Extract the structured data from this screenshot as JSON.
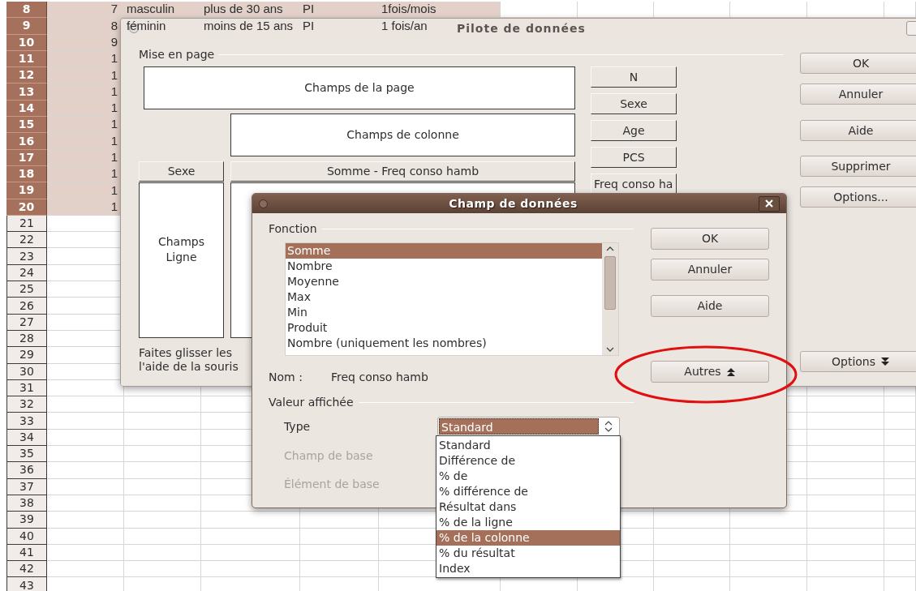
{
  "sheet": {
    "rows": [
      {
        "header": "8",
        "selected": true,
        "cells": [
          "7",
          "masculin",
          "plus de 30 ans",
          "PI",
          "1fois/mois"
        ]
      },
      {
        "header": "9",
        "selected": true,
        "cells": [
          "8",
          "féminin",
          "moins de 15 ans",
          "PI",
          "1 fois/an"
        ]
      },
      {
        "header": "10",
        "selected": true,
        "cells": [
          "9"
        ]
      },
      {
        "header": "11",
        "selected": true,
        "cells": [
          "1"
        ]
      },
      {
        "header": "12",
        "selected": true,
        "cells": [
          "1"
        ]
      },
      {
        "header": "13",
        "selected": true,
        "cells": [
          "1"
        ]
      },
      {
        "header": "14",
        "selected": true,
        "cells": [
          "1"
        ]
      },
      {
        "header": "15",
        "selected": true,
        "cells": [
          "1"
        ]
      },
      {
        "header": "16",
        "selected": true,
        "cells": [
          "1"
        ]
      },
      {
        "header": "17",
        "selected": true,
        "cells": [
          "1"
        ]
      },
      {
        "header": "18",
        "selected": true,
        "cells": [
          "1"
        ]
      },
      {
        "header": "19",
        "selected": true,
        "cells": [
          "1"
        ]
      },
      {
        "header": "20",
        "selected": true,
        "cells": [
          "1"
        ]
      },
      {
        "header": "21",
        "selected": false
      },
      {
        "header": "22",
        "selected": false
      },
      {
        "header": "23",
        "selected": false
      },
      {
        "header": "24",
        "selected": false
      },
      {
        "header": "25",
        "selected": false
      },
      {
        "header": "26",
        "selected": false
      },
      {
        "header": "27",
        "selected": false
      },
      {
        "header": "28",
        "selected": false
      },
      {
        "header": "29",
        "selected": false
      },
      {
        "header": "30",
        "selected": false
      },
      {
        "header": "31",
        "selected": false
      },
      {
        "header": "32",
        "selected": false
      },
      {
        "header": "33",
        "selected": false
      },
      {
        "header": "34",
        "selected": false
      },
      {
        "header": "35",
        "selected": false
      },
      {
        "header": "36",
        "selected": false
      },
      {
        "header": "37",
        "selected": false
      },
      {
        "header": "38",
        "selected": false
      },
      {
        "header": "39",
        "selected": false
      },
      {
        "header": "40",
        "selected": false
      },
      {
        "header": "41",
        "selected": false
      },
      {
        "header": "42",
        "selected": false
      },
      {
        "header": "43",
        "selected": false
      }
    ]
  },
  "pilot_dialog": {
    "title": "Pilote de données",
    "layout_label": "Mise en page",
    "page_area": "Champs de la page",
    "column_area": "Champs de colonne",
    "row_field": "Sexe",
    "data_field": "Somme - Freq conso hamb",
    "row_area": "Champs Ligne",
    "hint": "Faites glisser les\nl'aide de la souris",
    "field_buttons": [
      "N",
      "Sexe",
      "Age",
      "PCS",
      "Freq conso ha"
    ],
    "buttons": [
      "OK",
      "Annuler",
      "Aide",
      "Supprimer",
      "Options..."
    ],
    "options_button": "Options"
  },
  "field_dialog": {
    "title": "Champ de données",
    "function_label": "Fonction",
    "functions": [
      {
        "label": "Somme",
        "selected": true
      },
      {
        "label": "Nombre",
        "selected": false
      },
      {
        "label": "Moyenne",
        "selected": false
      },
      {
        "label": "Max",
        "selected": false
      },
      {
        "label": "Min",
        "selected": false
      },
      {
        "label": "Produit",
        "selected": false
      },
      {
        "label": "Nombre (uniquement les nombres)",
        "selected": false
      }
    ],
    "name_label": "Nom :",
    "name_value": "Freq conso hamb",
    "displayed_label": "Valeur affichée",
    "type": {
      "label": "Type",
      "value": "Standard"
    },
    "base_rows": [
      {
        "label": "Champ de base",
        "disabled": true
      },
      {
        "label": "Élément de base",
        "disabled": true
      }
    ],
    "buttons": [
      "OK",
      "Annuler",
      "Aide"
    ],
    "more_button": "Autres"
  },
  "type_dropdown": {
    "options": [
      {
        "label": "Standard",
        "selected": false
      },
      {
        "label": "Différence de",
        "selected": false
      },
      {
        "label": "% de",
        "selected": false
      },
      {
        "label": "% différence de",
        "selected": false
      },
      {
        "label": "Résultat dans",
        "selected": false
      },
      {
        "label": "% de la ligne",
        "selected": false
      },
      {
        "label": "% de la colonne",
        "selected": true
      },
      {
        "label": "% du résultat",
        "selected": false
      },
      {
        "label": "Index",
        "selected": false
      }
    ]
  }
}
